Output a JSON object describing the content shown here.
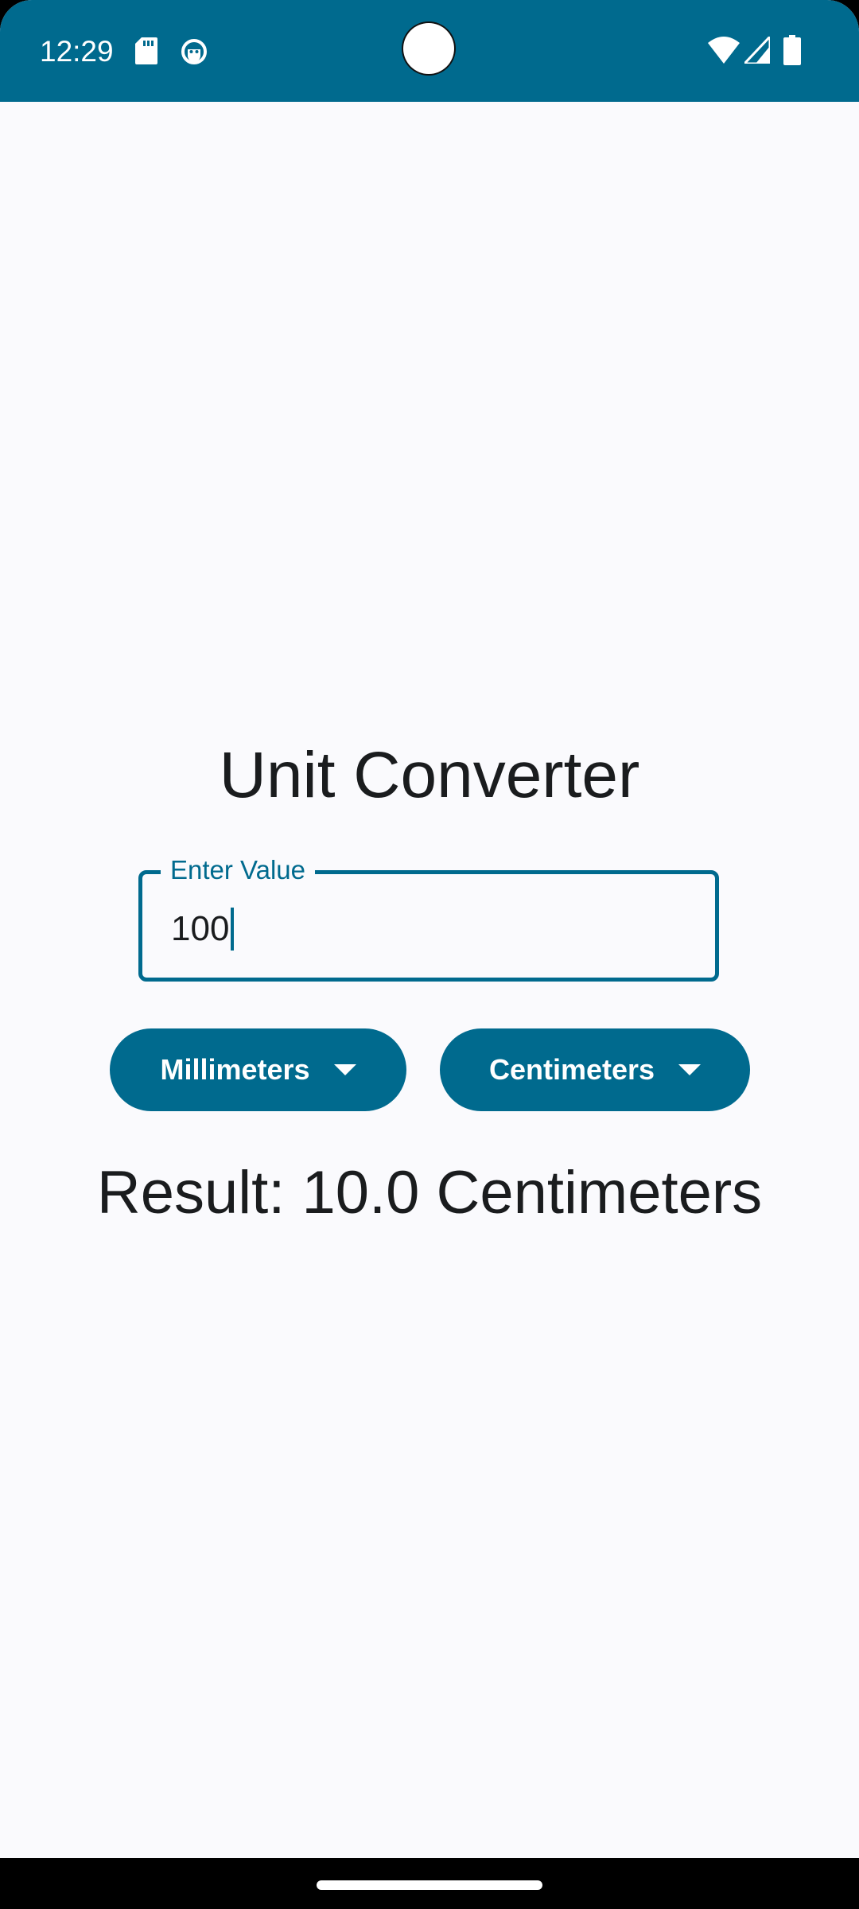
{
  "status_bar": {
    "time": "12:29",
    "left_icons": [
      "sd-card-icon",
      "face-icon"
    ],
    "right_icons": [
      "wifi-icon",
      "signal-icon",
      "battery-icon"
    ],
    "color": "#006A8E"
  },
  "app": {
    "title": "Unit Converter",
    "input": {
      "label": "Enter Value",
      "value": "100"
    },
    "from_unit": {
      "label": "Millimeters"
    },
    "to_unit": {
      "label": "Centimeters"
    },
    "result": "Result: 10.0 Centimeters"
  },
  "colors": {
    "primary": "#006A8E",
    "background": "#FAFAFD",
    "text": "#1A1C1E"
  }
}
